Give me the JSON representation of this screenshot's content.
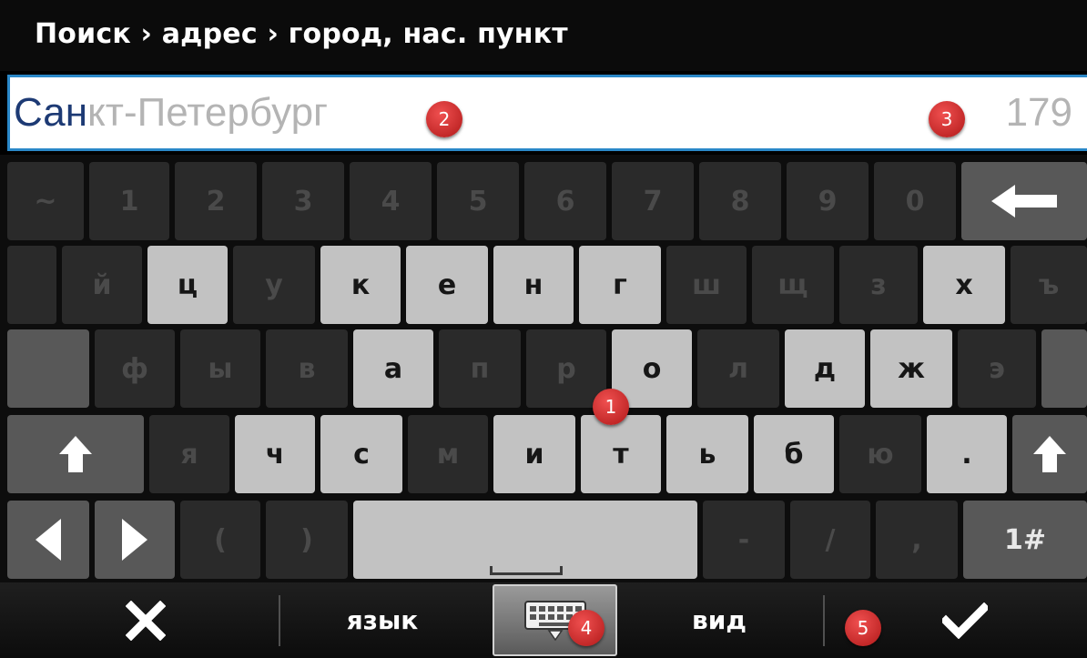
{
  "header": {
    "title": "Поиск › адрес › город, нас. пункт"
  },
  "search": {
    "typed": "Сан",
    "suggestion_rest": "кт-Петербург",
    "result_count": "179"
  },
  "keyboard": {
    "row1": [
      "~",
      "1",
      "2",
      "3",
      "4",
      "5",
      "6",
      "7",
      "8",
      "9",
      "0"
    ],
    "backspace_icon": "backspace-arrow-icon",
    "row2": [
      "й",
      "ц",
      "у",
      "к",
      "е",
      "н",
      "г",
      "ш",
      "щ",
      "з",
      "х",
      "ъ"
    ],
    "row3": [
      "ф",
      "ы",
      "в",
      "а",
      "п",
      "р",
      "о",
      "л",
      "д",
      "ж",
      "э"
    ],
    "row4": [
      "я",
      "ч",
      "с",
      "м",
      "и",
      "т",
      "ь",
      "б",
      "ю",
      "."
    ],
    "row5": {
      "open_paren": "(",
      "close_paren": ")",
      "dash": "-",
      "slash": "/",
      "comma": ",",
      "mode": "1#"
    }
  },
  "bottombar": {
    "cancel_icon": "close-icon",
    "lang": "язык",
    "view": "вид",
    "ok_icon": "checkmark-icon"
  },
  "markers": [
    "1",
    "2",
    "3",
    "4",
    "5"
  ],
  "colors": {
    "accent_border": "#2a88c8",
    "marker": "#d62a2a",
    "key_active": "#c2c2c2",
    "key_inactive": "#2a2a2a"
  }
}
